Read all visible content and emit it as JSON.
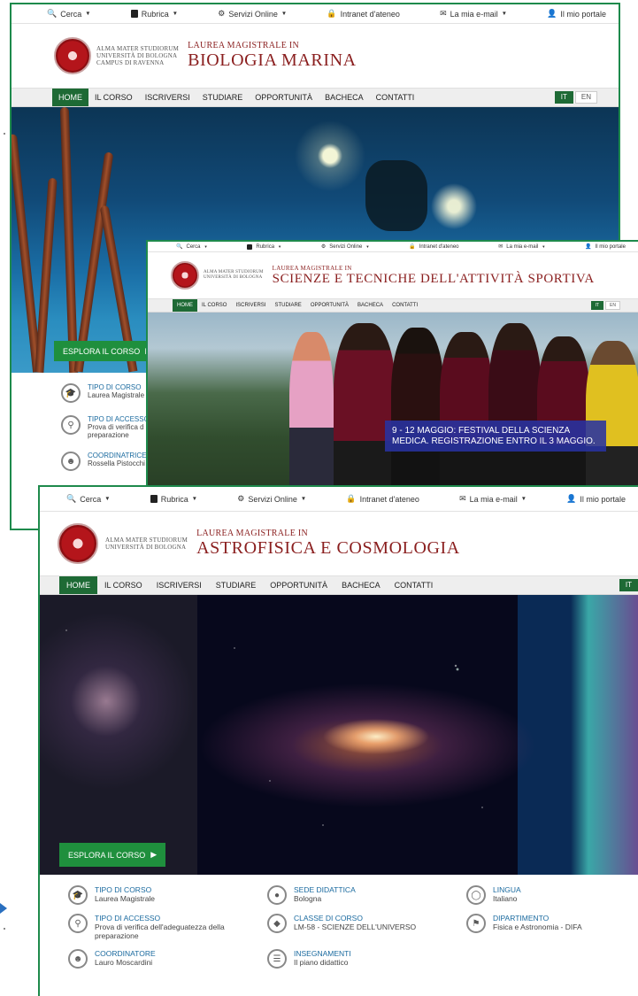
{
  "utility_bar": {
    "search": "Cerca",
    "directory": "Rubrica",
    "online_services": "Servizi Online",
    "intranet": "Intranet d'ateneo",
    "email": "La mia e-mail",
    "portal": "Il mio portale"
  },
  "university": {
    "line1": "Alma Mater Studiorum",
    "line2": "Università di Bologna",
    "line3": "Campus di Ravenna"
  },
  "nav": [
    "HOME",
    "IL CORSO",
    "ISCRIVERSI",
    "STUDIARE",
    "OPPORTUNITÀ",
    "BACHECA",
    "CONTATTI"
  ],
  "lang": {
    "it": "IT",
    "en": "EN"
  },
  "explore_label": "ESPLORA IL CORSO",
  "shot1": {
    "degree_type": "Laurea Magistrale in",
    "degree_name": "Biologia Marina",
    "info": [
      {
        "title": "TIPO DI CORSO",
        "value": "Laurea Magistrale"
      },
      {
        "title": "TIPO DI ACCESSO",
        "value": "Prova di verifica d",
        "value2": "preparazione"
      },
      {
        "title": "COORDINATRICE",
        "value": "Rossella Pistocchi"
      }
    ]
  },
  "shot2": {
    "degree_type": "Laurea Magistrale in",
    "degree_name": "Scienze e Tecniche dell'attività sportiva",
    "news": "9 - 12 MAGGIO: FESTIVAL DELLA SCIENZA MEDICA. REGISTRAZIONE ENTRO IL 3 MAGGIO."
  },
  "shot3": {
    "degree_type": "Laurea Magistrale in",
    "degree_name": "Astrofisica e Cosmologia",
    "info": [
      {
        "title": "TIPO DI CORSO",
        "value": "Laurea Magistrale",
        "icon": "graduation-cap-icon"
      },
      {
        "title": "SEDE DIDATTICA",
        "value": "Bologna",
        "icon": "map-pin-icon"
      },
      {
        "title": "LINGUA",
        "value": "Italiano",
        "icon": "globe-icon"
      },
      {
        "title": "TIPO DI ACCESSO",
        "value": "Prova di verifica dell'adeguatezza della preparazione",
        "icon": "key-icon"
      },
      {
        "title": "CLASSE DI CORSO",
        "value": "LM-58 - SCIENZE DELL'UNIVERSO",
        "icon": "tag-icon"
      },
      {
        "title": "DIPARTIMENTO",
        "value": "Fisica e Astronomia - DIFA",
        "icon": "institution-icon"
      },
      {
        "title": "COORDINATORE",
        "value": "Lauro Moscardini",
        "icon": "user-icon"
      },
      {
        "title": "INSEGNAMENTI",
        "value": "Il piano didattico",
        "icon": "list-icon"
      }
    ]
  },
  "colors": {
    "brand_green": "#1e6a35",
    "frame_green": "#1e8a4c",
    "seal_red": "#b4151b",
    "link_blue": "#1a6a9f",
    "news_blue": "#2832a0"
  }
}
